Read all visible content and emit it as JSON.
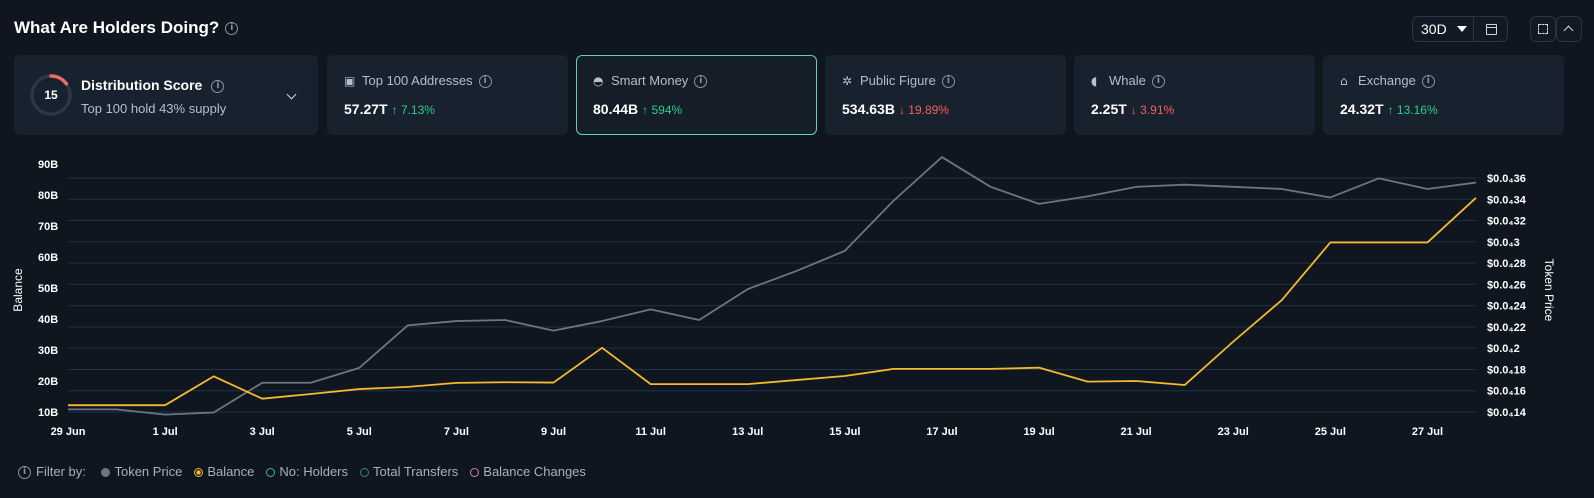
{
  "header": {
    "title": "What Are Holders Doing?",
    "range": "30D"
  },
  "cards": {
    "distribution": {
      "score": "15",
      "title": "Distribution Score",
      "subtitle": "Top 100 hold 43% supply"
    },
    "items": [
      {
        "label": "Top 100 Addresses",
        "value": "57.27T",
        "change": "↑ 7.13%",
        "direction": "up"
      },
      {
        "label": "Smart Money",
        "value": "80.44B",
        "change": "↑ 594%",
        "direction": "up"
      },
      {
        "label": "Public Figure",
        "value": "534.63B",
        "change": "↓ 19.89%",
        "direction": "down"
      },
      {
        "label": "Whale",
        "value": "2.25T",
        "change": "↓ 3.91%",
        "direction": "down"
      },
      {
        "label": "Exchange",
        "value": "24.32T",
        "change": "↑ 13.16%",
        "direction": "up"
      }
    ]
  },
  "legend": {
    "prefix": "Filter by:",
    "items": [
      {
        "label": "Token Price",
        "color": "#6b7683",
        "filled": true
      },
      {
        "label": "Balance",
        "color": "#f5b82e",
        "filled": false,
        "selected": true
      },
      {
        "label": "No: Holders",
        "color": "#3fb3a8",
        "filled": false
      },
      {
        "label": "Total Transfers",
        "color": "#1f8a88",
        "filled": false
      },
      {
        "label": "Balance Changes",
        "color": "#d97aa6",
        "filled": false
      }
    ]
  },
  "chart_data": {
    "type": "line",
    "ylabel": "Balance",
    "y2label": "Token Price",
    "x_ticks": [
      "29 Jun",
      "1 Jul",
      "3 Jul",
      "5 Jul",
      "7 Jul",
      "9 Jul",
      "11 Jul",
      "13 Jul",
      "15 Jul",
      "17 Jul",
      "19 Jul",
      "21 Jul",
      "23 Jul",
      "25 Jul",
      "27 Jul"
    ],
    "x": [
      "29 Jun",
      "30 Jun",
      "1 Jul",
      "2 Jul",
      "3 Jul",
      "4 Jul",
      "5 Jul",
      "6 Jul",
      "7 Jul",
      "8 Jul",
      "9 Jul",
      "10 Jul",
      "11 Jul",
      "12 Jul",
      "13 Jul",
      "14 Jul",
      "15 Jul",
      "16 Jul",
      "17 Jul",
      "18 Jul",
      "19 Jul",
      "20 Jul",
      "21 Jul",
      "22 Jul",
      "23 Jul",
      "24 Jul",
      "25 Jul",
      "26 Jul",
      "27 Jul",
      "28 Jul"
    ],
    "y_ticks": [
      "10B",
      "20B",
      "30B",
      "40B",
      "50B",
      "60B",
      "70B",
      "80B",
      "90B"
    ],
    "ylim": [
      10,
      90
    ],
    "y2_ticks": [
      "$0.0₄14",
      "$0.0₄16",
      "$0.0₄18",
      "$0.0₄2",
      "$0.0₄22",
      "$0.0₄24",
      "$0.0₄26",
      "$0.0₄28",
      "$0.0₄3",
      "$0.0₄32",
      "$0.0₄34",
      "$0.0₄36"
    ],
    "y2lim": [
      0.14,
      0.36
    ],
    "series": [
      {
        "name": "Token Price",
        "color": "#6b7683",
        "axis": "right",
        "values": [
          0.1425,
          0.1425,
          0.1375,
          0.1395,
          0.1675,
          0.1675,
          0.1815,
          0.2215,
          0.2255,
          0.2265,
          0.2165,
          0.2255,
          0.2365,
          0.2265,
          0.2555,
          0.2725,
          0.2915,
          0.3385,
          0.3797,
          0.3517,
          0.3357,
          0.3427,
          0.3517,
          0.3537,
          0.3517,
          0.3497,
          0.3417,
          0.3597,
          0.3497,
          0.3557
        ]
      },
      {
        "name": "Balance",
        "color": "#f5b82e",
        "axis": "left",
        "values": [
          12.2,
          12.2,
          12.2,
          21.5,
          14.3,
          15.8,
          17.4,
          18.1,
          19.4,
          19.6,
          19.5,
          30.7,
          19.0,
          19.0,
          19.0,
          20.3,
          21.6,
          23.9,
          23.9,
          23.9,
          24.3,
          19.8,
          20.0,
          18.7,
          32.7,
          46.1,
          64.7,
          64.7,
          64.7,
          79.1
        ]
      }
    ]
  }
}
